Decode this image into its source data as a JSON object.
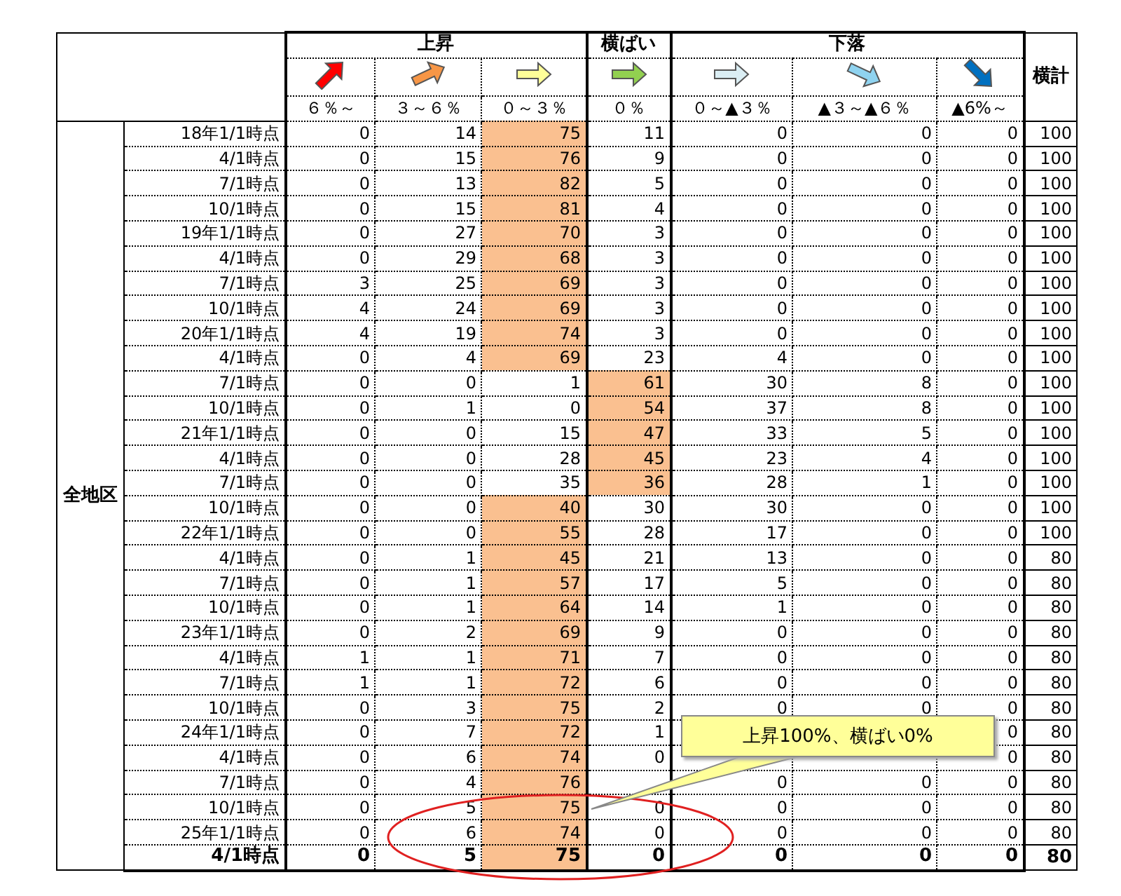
{
  "table": {
    "region": "全地区",
    "total_header": "横計",
    "groups": [
      {
        "label": "上昇",
        "columns": [
          "６％～",
          "３～６％",
          "０～３％"
        ]
      },
      {
        "label": "横ばい",
        "columns": [
          "０％"
        ]
      },
      {
        "label": "下落",
        "columns": [
          "０～▲３％",
          "▲３～▲６％",
          "▲6%～"
        ]
      }
    ],
    "rows": [
      {
        "label": "18年1/1時点",
        "bold": false,
        "total": "100",
        "cells": [
          {
            "value": "0",
            "highlighted": false
          },
          {
            "value": "14",
            "highlighted": false
          },
          {
            "value": "75",
            "highlighted": true
          },
          {
            "value": "11",
            "highlighted": false
          },
          {
            "value": "0",
            "highlighted": false
          },
          {
            "value": "0",
            "highlighted": false
          },
          {
            "value": "0",
            "highlighted": false
          }
        ]
      },
      {
        "label": "4/1時点",
        "bold": false,
        "total": "100",
        "cells": [
          {
            "value": "0",
            "highlighted": false
          },
          {
            "value": "15",
            "highlighted": false
          },
          {
            "value": "76",
            "highlighted": true
          },
          {
            "value": "9",
            "highlighted": false
          },
          {
            "value": "0",
            "highlighted": false
          },
          {
            "value": "0",
            "highlighted": false
          },
          {
            "value": "0",
            "highlighted": false
          }
        ]
      },
      {
        "label": "7/1時点",
        "bold": false,
        "total": "100",
        "cells": [
          {
            "value": "0",
            "highlighted": false
          },
          {
            "value": "13",
            "highlighted": false
          },
          {
            "value": "82",
            "highlighted": true
          },
          {
            "value": "5",
            "highlighted": false
          },
          {
            "value": "0",
            "highlighted": false
          },
          {
            "value": "0",
            "highlighted": false
          },
          {
            "value": "0",
            "highlighted": false
          }
        ]
      },
      {
        "label": "10/1時点",
        "bold": false,
        "total": "100",
        "cells": [
          {
            "value": "0",
            "highlighted": false
          },
          {
            "value": "15",
            "highlighted": false
          },
          {
            "value": "81",
            "highlighted": true
          },
          {
            "value": "4",
            "highlighted": false
          },
          {
            "value": "0",
            "highlighted": false
          },
          {
            "value": "0",
            "highlighted": false
          },
          {
            "value": "0",
            "highlighted": false
          }
        ]
      },
      {
        "label": "19年1/1時点",
        "bold": false,
        "total": "100",
        "cells": [
          {
            "value": "0",
            "highlighted": false
          },
          {
            "value": "27",
            "highlighted": false
          },
          {
            "value": "70",
            "highlighted": true
          },
          {
            "value": "3",
            "highlighted": false
          },
          {
            "value": "0",
            "highlighted": false
          },
          {
            "value": "0",
            "highlighted": false
          },
          {
            "value": "0",
            "highlighted": false
          }
        ]
      },
      {
        "label": "4/1時点",
        "bold": false,
        "total": "100",
        "cells": [
          {
            "value": "0",
            "highlighted": false
          },
          {
            "value": "29",
            "highlighted": false
          },
          {
            "value": "68",
            "highlighted": true
          },
          {
            "value": "3",
            "highlighted": false
          },
          {
            "value": "0",
            "highlighted": false
          },
          {
            "value": "0",
            "highlighted": false
          },
          {
            "value": "0",
            "highlighted": false
          }
        ]
      },
      {
        "label": "7/1時点",
        "bold": false,
        "total": "100",
        "cells": [
          {
            "value": "3",
            "highlighted": false
          },
          {
            "value": "25",
            "highlighted": false
          },
          {
            "value": "69",
            "highlighted": true
          },
          {
            "value": "3",
            "highlighted": false
          },
          {
            "value": "0",
            "highlighted": false
          },
          {
            "value": "0",
            "highlighted": false
          },
          {
            "value": "0",
            "highlighted": false
          }
        ]
      },
      {
        "label": "10/1時点",
        "bold": false,
        "total": "100",
        "cells": [
          {
            "value": "4",
            "highlighted": false
          },
          {
            "value": "24",
            "highlighted": false
          },
          {
            "value": "69",
            "highlighted": true
          },
          {
            "value": "3",
            "highlighted": false
          },
          {
            "value": "0",
            "highlighted": false
          },
          {
            "value": "0",
            "highlighted": false
          },
          {
            "value": "0",
            "highlighted": false
          }
        ]
      },
      {
        "label": "20年1/1時点",
        "bold": false,
        "total": "100",
        "cells": [
          {
            "value": "4",
            "highlighted": false
          },
          {
            "value": "19",
            "highlighted": false
          },
          {
            "value": "74",
            "highlighted": true
          },
          {
            "value": "3",
            "highlighted": false
          },
          {
            "value": "0",
            "highlighted": false
          },
          {
            "value": "0",
            "highlighted": false
          },
          {
            "value": "0",
            "highlighted": false
          }
        ]
      },
      {
        "label": "4/1時点",
        "bold": false,
        "total": "100",
        "cells": [
          {
            "value": "0",
            "highlighted": false
          },
          {
            "value": "4",
            "highlighted": false
          },
          {
            "value": "69",
            "highlighted": true
          },
          {
            "value": "23",
            "highlighted": false
          },
          {
            "value": "4",
            "highlighted": false
          },
          {
            "value": "0",
            "highlighted": false
          },
          {
            "value": "0",
            "highlighted": false
          }
        ]
      },
      {
        "label": "7/1時点",
        "bold": false,
        "total": "100",
        "cells": [
          {
            "value": "0",
            "highlighted": false
          },
          {
            "value": "0",
            "highlighted": false
          },
          {
            "value": "1",
            "highlighted": false
          },
          {
            "value": "61",
            "highlighted": true
          },
          {
            "value": "30",
            "highlighted": false
          },
          {
            "value": "8",
            "highlighted": false
          },
          {
            "value": "0",
            "highlighted": false
          }
        ]
      },
      {
        "label": "10/1時点",
        "bold": false,
        "total": "100",
        "cells": [
          {
            "value": "0",
            "highlighted": false
          },
          {
            "value": "1",
            "highlighted": false
          },
          {
            "value": "0",
            "highlighted": false
          },
          {
            "value": "54",
            "highlighted": true
          },
          {
            "value": "37",
            "highlighted": false
          },
          {
            "value": "8",
            "highlighted": false
          },
          {
            "value": "0",
            "highlighted": false
          }
        ]
      },
      {
        "label": "21年1/1時点",
        "bold": false,
        "total": "100",
        "cells": [
          {
            "value": "0",
            "highlighted": false
          },
          {
            "value": "0",
            "highlighted": false
          },
          {
            "value": "15",
            "highlighted": false
          },
          {
            "value": "47",
            "highlighted": true
          },
          {
            "value": "33",
            "highlighted": false
          },
          {
            "value": "5",
            "highlighted": false
          },
          {
            "value": "0",
            "highlighted": false
          }
        ]
      },
      {
        "label": "4/1時点",
        "bold": false,
        "total": "100",
        "cells": [
          {
            "value": "0",
            "highlighted": false
          },
          {
            "value": "0",
            "highlighted": false
          },
          {
            "value": "28",
            "highlighted": false
          },
          {
            "value": "45",
            "highlighted": true
          },
          {
            "value": "23",
            "highlighted": false
          },
          {
            "value": "4",
            "highlighted": false
          },
          {
            "value": "0",
            "highlighted": false
          }
        ]
      },
      {
        "label": "7/1時点",
        "bold": false,
        "total": "100",
        "cells": [
          {
            "value": "0",
            "highlighted": false
          },
          {
            "value": "0",
            "highlighted": false
          },
          {
            "value": "35",
            "highlighted": false
          },
          {
            "value": "36",
            "highlighted": true
          },
          {
            "value": "28",
            "highlighted": false
          },
          {
            "value": "1",
            "highlighted": false
          },
          {
            "value": "0",
            "highlighted": false
          }
        ]
      },
      {
        "label": "10/1時点",
        "bold": false,
        "total": "100",
        "cells": [
          {
            "value": "0",
            "highlighted": false
          },
          {
            "value": "0",
            "highlighted": false
          },
          {
            "value": "40",
            "highlighted": true
          },
          {
            "value": "30",
            "highlighted": false
          },
          {
            "value": "30",
            "highlighted": false
          },
          {
            "value": "0",
            "highlighted": false
          },
          {
            "value": "0",
            "highlighted": false
          }
        ]
      },
      {
        "label": "22年1/1時点",
        "bold": false,
        "total": "100",
        "cells": [
          {
            "value": "0",
            "highlighted": false
          },
          {
            "value": "0",
            "highlighted": false
          },
          {
            "value": "55",
            "highlighted": true
          },
          {
            "value": "28",
            "highlighted": false
          },
          {
            "value": "17",
            "highlighted": false
          },
          {
            "value": "0",
            "highlighted": false
          },
          {
            "value": "0",
            "highlighted": false
          }
        ]
      },
      {
        "label": "4/1時点",
        "bold": false,
        "total": "80",
        "cells": [
          {
            "value": "0",
            "highlighted": false
          },
          {
            "value": "1",
            "highlighted": false
          },
          {
            "value": "45",
            "highlighted": true
          },
          {
            "value": "21",
            "highlighted": false
          },
          {
            "value": "13",
            "highlighted": false
          },
          {
            "value": "0",
            "highlighted": false
          },
          {
            "value": "0",
            "highlighted": false
          }
        ]
      },
      {
        "label": "7/1時点",
        "bold": false,
        "total": "80",
        "cells": [
          {
            "value": "0",
            "highlighted": false
          },
          {
            "value": "1",
            "highlighted": false
          },
          {
            "value": "57",
            "highlighted": true
          },
          {
            "value": "17",
            "highlighted": false
          },
          {
            "value": "5",
            "highlighted": false
          },
          {
            "value": "0",
            "highlighted": false
          },
          {
            "value": "0",
            "highlighted": false
          }
        ]
      },
      {
        "label": "10/1時点",
        "bold": false,
        "total": "80",
        "cells": [
          {
            "value": "0",
            "highlighted": false
          },
          {
            "value": "1",
            "highlighted": false
          },
          {
            "value": "64",
            "highlighted": true
          },
          {
            "value": "14",
            "highlighted": false
          },
          {
            "value": "1",
            "highlighted": false
          },
          {
            "value": "0",
            "highlighted": false
          },
          {
            "value": "0",
            "highlighted": false
          }
        ]
      },
      {
        "label": "23年1/1時点",
        "bold": false,
        "total": "80",
        "cells": [
          {
            "value": "0",
            "highlighted": false
          },
          {
            "value": "2",
            "highlighted": false
          },
          {
            "value": "69",
            "highlighted": true
          },
          {
            "value": "9",
            "highlighted": false
          },
          {
            "value": "0",
            "highlighted": false
          },
          {
            "value": "0",
            "highlighted": false
          },
          {
            "value": "0",
            "highlighted": false
          }
        ]
      },
      {
        "label": "4/1時点",
        "bold": false,
        "total": "80",
        "cells": [
          {
            "value": "1",
            "highlighted": false
          },
          {
            "value": "1",
            "highlighted": false
          },
          {
            "value": "71",
            "highlighted": true
          },
          {
            "value": "7",
            "highlighted": false
          },
          {
            "value": "0",
            "highlighted": false
          },
          {
            "value": "0",
            "highlighted": false
          },
          {
            "value": "0",
            "highlighted": false
          }
        ]
      },
      {
        "label": "7/1時点",
        "bold": false,
        "total": "80",
        "cells": [
          {
            "value": "1",
            "highlighted": false
          },
          {
            "value": "1",
            "highlighted": false
          },
          {
            "value": "72",
            "highlighted": true
          },
          {
            "value": "6",
            "highlighted": false
          },
          {
            "value": "0",
            "highlighted": false
          },
          {
            "value": "0",
            "highlighted": false
          },
          {
            "value": "0",
            "highlighted": false
          }
        ]
      },
      {
        "label": "10/1時点",
        "bold": false,
        "total": "80",
        "cells": [
          {
            "value": "0",
            "highlighted": false
          },
          {
            "value": "3",
            "highlighted": false
          },
          {
            "value": "75",
            "highlighted": true
          },
          {
            "value": "2",
            "highlighted": false
          },
          {
            "value": "0",
            "highlighted": false
          },
          {
            "value": "0",
            "highlighted": false
          },
          {
            "value": "0",
            "highlighted": false
          }
        ]
      },
      {
        "label": "24年1/1時点",
        "bold": false,
        "total": "80",
        "cells": [
          {
            "value": "0",
            "highlighted": false
          },
          {
            "value": "7",
            "highlighted": false
          },
          {
            "value": "72",
            "highlighted": true
          },
          {
            "value": "1",
            "highlighted": false
          },
          {},
          {},
          {
            "value": "0",
            "highlighted": false
          }
        ]
      },
      {
        "label": "4/1時点",
        "bold": false,
        "total": "80",
        "cells": [
          {
            "value": "0",
            "highlighted": false
          },
          {
            "value": "6",
            "highlighted": false
          },
          {
            "value": "74",
            "highlighted": true
          },
          {
            "value": "0",
            "highlighted": false
          },
          {},
          {},
          {
            "value": "0",
            "highlighted": false
          }
        ]
      },
      {
        "label": "7/1時点",
        "bold": false,
        "total": "80",
        "cells": [
          {
            "value": "0",
            "highlighted": false
          },
          {
            "value": "4",
            "highlighted": false
          },
          {
            "value": "76",
            "highlighted": true
          },
          {},
          {
            "value": "0",
            "highlighted": false
          },
          {
            "value": "0",
            "highlighted": false
          },
          {
            "value": "0",
            "highlighted": false
          }
        ]
      },
      {
        "label": "10/1時点",
        "bold": false,
        "total": "80",
        "cells": [
          {
            "value": "0",
            "highlighted": false
          },
          {
            "value": "5",
            "highlighted": false
          },
          {
            "value": "75",
            "highlighted": true
          },
          {
            "value": "0",
            "highlighted": false
          },
          {
            "value": "0",
            "highlighted": false
          },
          {
            "value": "0",
            "highlighted": false
          },
          {
            "value": "0",
            "highlighted": false
          }
        ]
      },
      {
        "label": "25年1/1時点",
        "bold": false,
        "total": "80",
        "cells": [
          {
            "value": "0",
            "highlighted": false
          },
          {
            "value": "6",
            "highlighted": false
          },
          {
            "value": "74",
            "highlighted": true
          },
          {
            "value": "0",
            "highlighted": false
          },
          {
            "value": "0",
            "highlighted": false
          },
          {
            "value": "0",
            "highlighted": false
          },
          {
            "value": "0",
            "highlighted": false
          }
        ]
      },
      {
        "label": "4/1時点",
        "bold": true,
        "total": "80",
        "cells": [
          {
            "value": "0",
            "highlighted": false
          },
          {
            "value": "5",
            "highlighted": false
          },
          {
            "value": "75",
            "highlighted": true
          },
          {
            "value": "0",
            "highlighted": false
          },
          {
            "value": "0",
            "highlighted": false
          },
          {
            "value": "0",
            "highlighted": false
          },
          {
            "value": "0",
            "highlighted": false
          }
        ]
      }
    ]
  },
  "callout": {
    "text": "上昇100%、横ばい0%"
  }
}
